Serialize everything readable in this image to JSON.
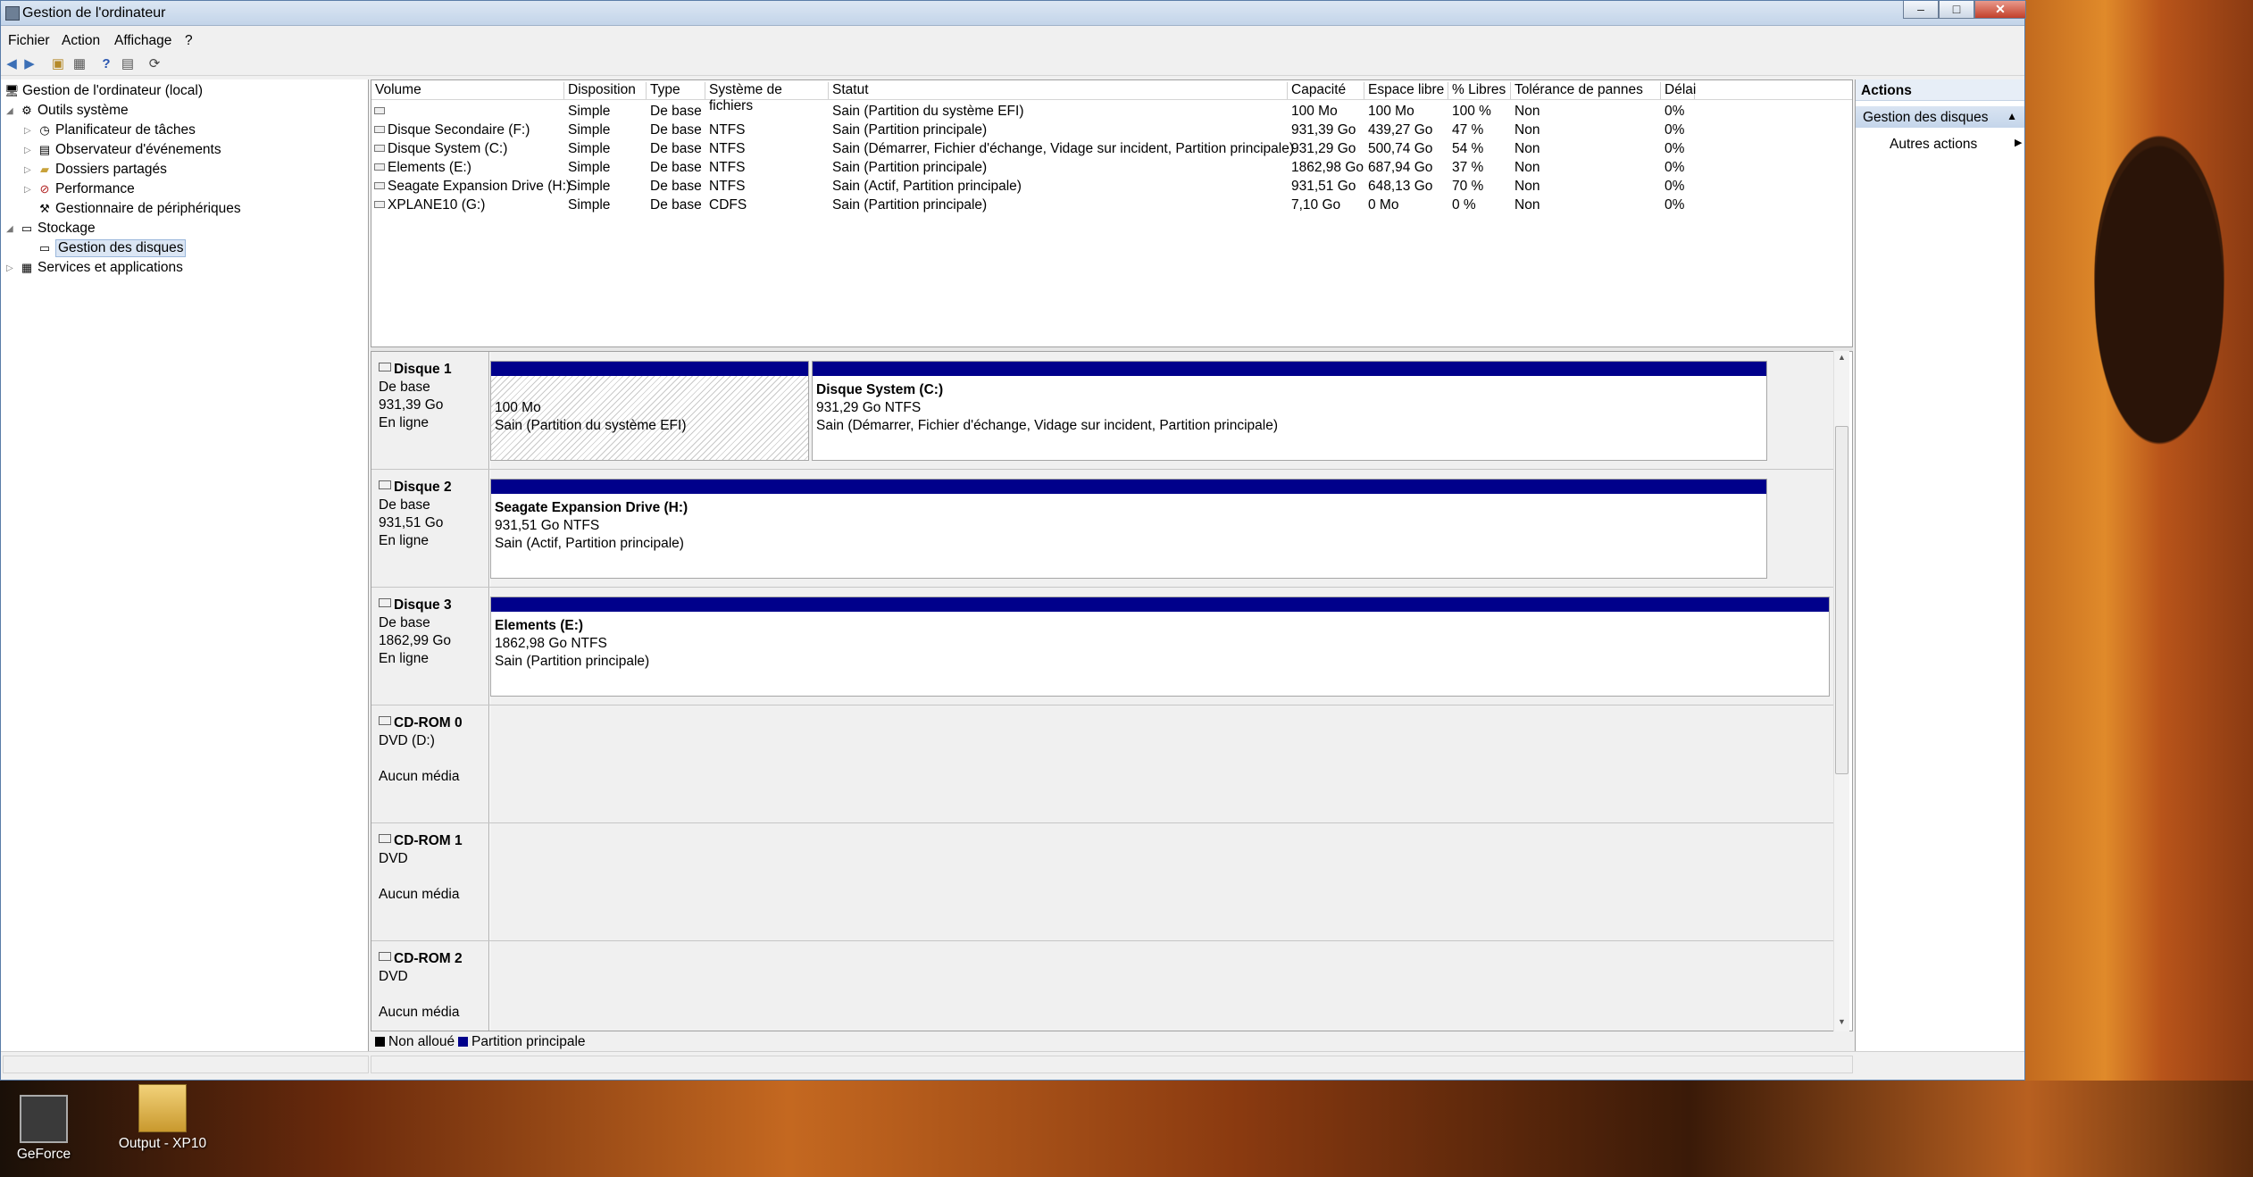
{
  "window": {
    "title": "Gestion de l'ordinateur",
    "min": "–",
    "max": "□",
    "close": "✕"
  },
  "menu": [
    "Fichier",
    "Action",
    "Affichage",
    "?"
  ],
  "tree": {
    "root": "Gestion de l'ordinateur (local)",
    "tools": "Outils système",
    "tools_children": [
      "Planificateur de tâches",
      "Observateur d'événements",
      "Dossiers partagés",
      "Performance",
      "Gestionnaire de périphériques"
    ],
    "storage": "Stockage",
    "disk_mgmt": "Gestion des disques",
    "services": "Services et applications"
  },
  "volumes": {
    "headers": [
      "Volume",
      "Disposition",
      "Type",
      "Système de fichiers",
      "Statut",
      "Capacité",
      "Espace libre",
      "% Libres",
      "Tolérance de pannes",
      "Délai"
    ],
    "rows": [
      [
        "",
        "Simple",
        "De base",
        "",
        "Sain (Partition du système EFI)",
        "100 Mo",
        "100 Mo",
        "100 %",
        "Non",
        "0%"
      ],
      [
        "Disque Secondaire (F:)",
        "Simple",
        "De base",
        "NTFS",
        "Sain (Partition principale)",
        "931,39 Go",
        "439,27 Go",
        "47 %",
        "Non",
        "0%"
      ],
      [
        "Disque System (C:)",
        "Simple",
        "De base",
        "NTFS",
        "Sain (Démarrer, Fichier d'échange, Vidage sur incident, Partition principale)",
        "931,29 Go",
        "500,74 Go",
        "54 %",
        "Non",
        "0%"
      ],
      [
        "Elements (E:)",
        "Simple",
        "De base",
        "NTFS",
        "Sain (Partition principale)",
        "1862,98 Go",
        "687,94 Go",
        "37 %",
        "Non",
        "0%"
      ],
      [
        "Seagate Expansion Drive (H:)",
        "Simple",
        "De base",
        "NTFS",
        "Sain (Actif, Partition principale)",
        "931,51 Go",
        "648,13 Go",
        "70 %",
        "Non",
        "0%"
      ],
      [
        "XPLANE10 (G:)",
        "Simple",
        "De base",
        "CDFS",
        "Sain (Partition principale)",
        "7,10 Go",
        "0 Mo",
        "0 %",
        "Non",
        "0%"
      ]
    ]
  },
  "disks": [
    {
      "name": "Disque 1",
      "type": "De base",
      "size": "931,39 Go",
      "state": "En ligne",
      "parts": [
        {
          "title": "",
          "size": "100 Mo",
          "status": "Sain (Partition du système EFI)"
        },
        {
          "title": "Disque System  (C:)",
          "size": "931,29 Go NTFS",
          "status": "Sain (Démarrer, Fichier d'échange, Vidage sur incident, Partition principale)"
        }
      ]
    },
    {
      "name": "Disque 2",
      "type": "De base",
      "size": "931,51 Go",
      "state": "En ligne",
      "parts": [
        {
          "title": "Seagate Expansion Drive  (H:)",
          "size": "931,51 Go NTFS",
          "status": "Sain (Actif, Partition principale)"
        }
      ]
    },
    {
      "name": "Disque 3",
      "type": "De base",
      "size": "1862,99 Go",
      "state": "En ligne",
      "parts": [
        {
          "title": "Elements  (E:)",
          "size": "1862,98 Go NTFS",
          "status": "Sain (Partition principale)"
        }
      ]
    }
  ],
  "cdroms": [
    {
      "name": "CD-ROM 0",
      "type": "DVD (D:)",
      "media": "Aucun média"
    },
    {
      "name": "CD-ROM 1",
      "type": "DVD",
      "media": "Aucun média"
    },
    {
      "name": "CD-ROM 2",
      "type": "DVD",
      "media": "Aucun média"
    }
  ],
  "legend": {
    "unallocated": "Non alloué",
    "primary": "Partition principale",
    "unallocated_color": "#000000",
    "primary_color": "#00008b"
  },
  "actions": {
    "header": "Actions",
    "section": "Gestion des disques",
    "more": "Autres actions"
  },
  "desktop": {
    "icon1": "GeForce",
    "icon2": "Output - XP10"
  }
}
